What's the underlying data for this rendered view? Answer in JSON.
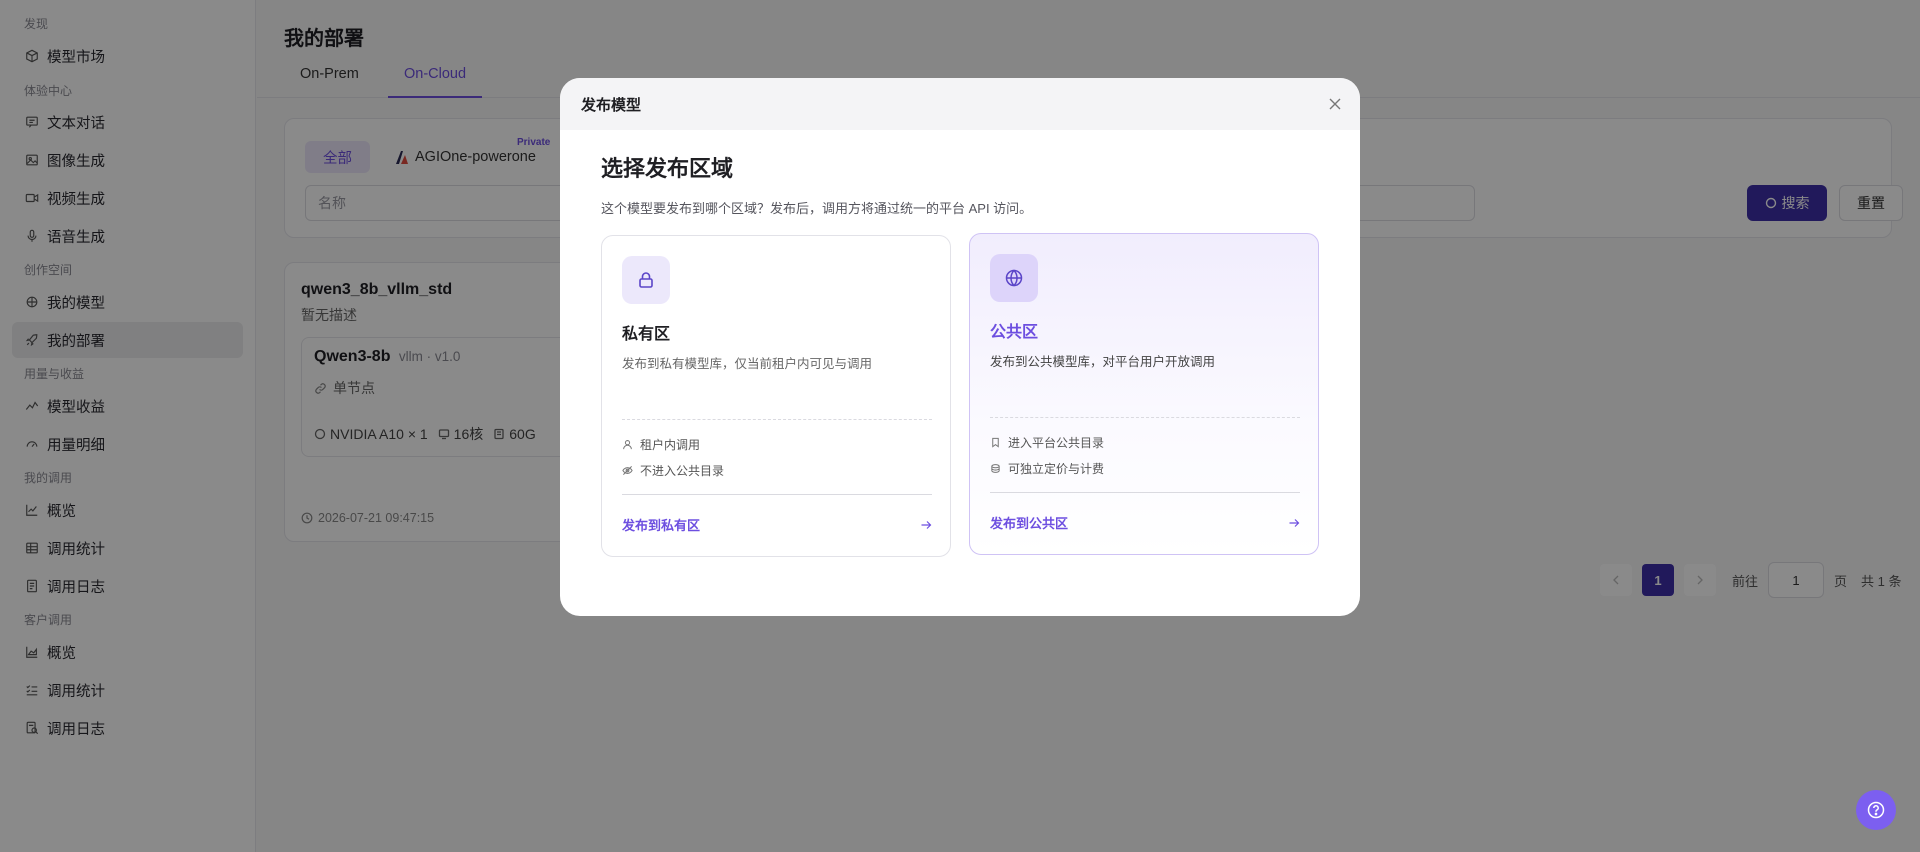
{
  "sidebar": {
    "groups": [
      "发现",
      "体验中心",
      "创作空间",
      "用量与收益",
      "我的调用",
      "客户调用"
    ],
    "items": [
      {
        "label": "模型市场",
        "icon": "cube-icon"
      },
      {
        "label": "文本对话",
        "icon": "chat-icon"
      },
      {
        "label": "图像生成",
        "icon": "image-icon"
      },
      {
        "label": "视频生成",
        "icon": "video-icon"
      },
      {
        "label": "语音生成",
        "icon": "mic-icon"
      },
      {
        "label": "我的模型",
        "icon": "model-icon"
      },
      {
        "label": "我的部署",
        "icon": "rocket-icon"
      },
      {
        "label": "模型收益",
        "icon": "trend-icon"
      },
      {
        "label": "用量明细",
        "icon": "gauge-icon"
      },
      {
        "label": "概览",
        "icon": "line-chart-icon"
      },
      {
        "label": "调用统计",
        "icon": "table-icon"
      },
      {
        "label": "调用日志",
        "icon": "log-icon"
      },
      {
        "label": "概览",
        "icon": "area-chart-icon"
      },
      {
        "label": "调用统计",
        "icon": "list-check-icon"
      },
      {
        "label": "调用日志",
        "icon": "log-search-icon"
      }
    ],
    "active_index": 6
  },
  "main": {
    "title": "我的部署",
    "tabs": [
      "On-Prem",
      "On-Cloud"
    ],
    "active_tab": 1,
    "filters": {
      "all_label": "全部",
      "org_label": "AGIOne-powerone",
      "private_tag": "Private",
      "name_placeholder": "名称",
      "search_label": "搜索",
      "reset_label": "重置"
    },
    "deployment": {
      "name": "qwen3_8b_vllm_std",
      "desc": "暂无描述",
      "model": "Qwen3-8b",
      "meta": "vllm · v1.0",
      "node": "单节点",
      "gpu": "NVIDIA A10 × 1",
      "cpu": "16核",
      "mem": "60G",
      "time": "2026-07-21 09:47:15"
    },
    "pagination": {
      "current": "1",
      "goto_label": "前往",
      "goto_value": "1",
      "page_unit": "页",
      "total": "共 1 条"
    }
  },
  "modal": {
    "header": "发布模型",
    "title": "选择发布区域",
    "subtitle": "这个模型要发布到哪个区域？发布后，调用方将通过统一的平台 API 访问。",
    "private_zone": {
      "name": "私有区",
      "desc": "发布到私有模型库，仅当前租户内可见与调用",
      "features": [
        "租户内调用",
        "不进入公共目录"
      ],
      "action": "发布到私有区",
      "icon": "lock-icon"
    },
    "public_zone": {
      "name": "公共区",
      "desc": "发布到公共模型库，对平台用户开放调用",
      "features": [
        "进入平台公共目录",
        "可独立定价与计费"
      ],
      "action": "发布到公共区",
      "icon": "globe-icon"
    }
  },
  "colors": {
    "accent": "#6d4fe0",
    "primary_button": "#3d2fa8",
    "help_fab": "#7c5ff0"
  }
}
